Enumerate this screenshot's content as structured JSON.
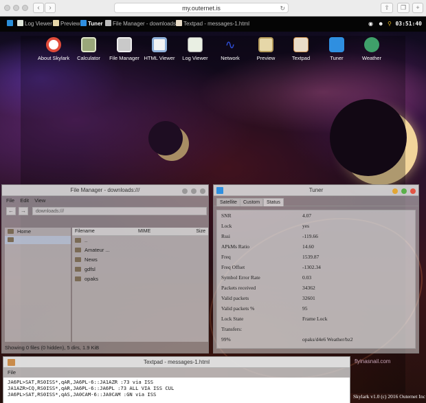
{
  "browser": {
    "url": "my.outernet.is"
  },
  "taskbar": {
    "items": [
      {
        "label": "Log Viewer",
        "icon": "log-viewer-icon"
      },
      {
        "label": "Preview",
        "icon": "preview-icon"
      },
      {
        "label": "Tuner",
        "icon": "tuner-icon",
        "active": true
      },
      {
        "label": "File Manager - downloads:///",
        "icon": "file-manager-icon"
      },
      {
        "label": "Textpad - messages-1.html",
        "icon": "textpad-icon"
      }
    ],
    "clock": "03:51:40"
  },
  "launcher": [
    {
      "label": "About Skylark",
      "icon": "lifebuoy-icon",
      "color": "#e04b3a"
    },
    {
      "label": "Calculator",
      "icon": "calculator-icon",
      "color": "#9aa77a"
    },
    {
      "label": "File Manager",
      "icon": "file-cabinet-icon",
      "color": "#c9c9c9"
    },
    {
      "label": "HTML Viewer",
      "icon": "globe-icon",
      "color": "#8fb0d9"
    },
    {
      "label": "Log Viewer",
      "icon": "checklist-icon",
      "color": "#e9efe3"
    },
    {
      "label": "Network",
      "icon": "wifi-icon",
      "color": "#2f4fd8"
    },
    {
      "label": "Preview",
      "icon": "picture-icon",
      "color": "#e6d7a8"
    },
    {
      "label": "Textpad",
      "icon": "notepad-icon",
      "color": "#e9dcc8"
    },
    {
      "label": "Tuner",
      "icon": "radio-signal-icon",
      "color": "#2f8fe0"
    },
    {
      "label": "Weather",
      "icon": "weather-icon",
      "color": "#3fa06a"
    }
  ],
  "file_manager": {
    "title": "File Manager - downloads:///",
    "menu": [
      "File",
      "Edit",
      "View"
    ],
    "path": "downloads:///",
    "sidebar": [
      {
        "label": "Home"
      },
      {
        "label": ""
      }
    ],
    "columns": [
      "Filename",
      "MIME",
      "Size"
    ],
    "rows": [
      {
        "name": ".."
      },
      {
        "name": "Amateur ..."
      },
      {
        "name": "News"
      },
      {
        "name": "gdfsl"
      },
      {
        "name": "opaks"
      }
    ],
    "status": "Showing 0 files (0 hidden), 5 dirs, 1.9 KiB"
  },
  "tuner": {
    "title": "Tuner",
    "tabs": [
      "Satellite",
      "Custom",
      "Status"
    ],
    "active_tab": "Status",
    "status": [
      {
        "key": "SNR",
        "value": "4.07"
      },
      {
        "key": "Lock",
        "value": "yes"
      },
      {
        "key": "Rssi",
        "value": "-119.66"
      },
      {
        "key": "APkMs Ratio",
        "value": "14.60"
      },
      {
        "key": "Freq",
        "value": "1539.87"
      },
      {
        "key": "Freq Offset",
        "value": "-1302.34"
      },
      {
        "key": "Symbol Error Rate",
        "value": "0.03"
      },
      {
        "key": "Packets received",
        "value": "34362"
      },
      {
        "key": "Valid packets",
        "value": "32601"
      },
      {
        "key": "Valid packets %",
        "value": "95"
      },
      {
        "key": "Lock State",
        "value": "Frame Lock"
      },
      {
        "key": "Transfers:",
        "value": ""
      },
      {
        "key": "99%",
        "value": "opaks/d4e6 Weather/bz2"
      }
    ]
  },
  "textpad": {
    "title": "Textpad - messages-1.html",
    "menu": [
      "File"
    ],
    "lines": [
      "JA6PL>SAT,RS0ISS*,qAR,JA6PL-6::JA1AZR   :73 via ISS",
      "JA1AZR>CQ,RS0ISS*,qAR,JA6PL-6::JA6PL    :73 ALL VIA ISS CUL",
      "JA6PL>SAT,RS0ISS*,qAS,JA0CAM-6::JA0CAM  :GN via ISS"
    ]
  },
  "watermark": "flyinasnail.com",
  "footer": "Skylark v1.0 (c) 2016 Outernet Inc"
}
